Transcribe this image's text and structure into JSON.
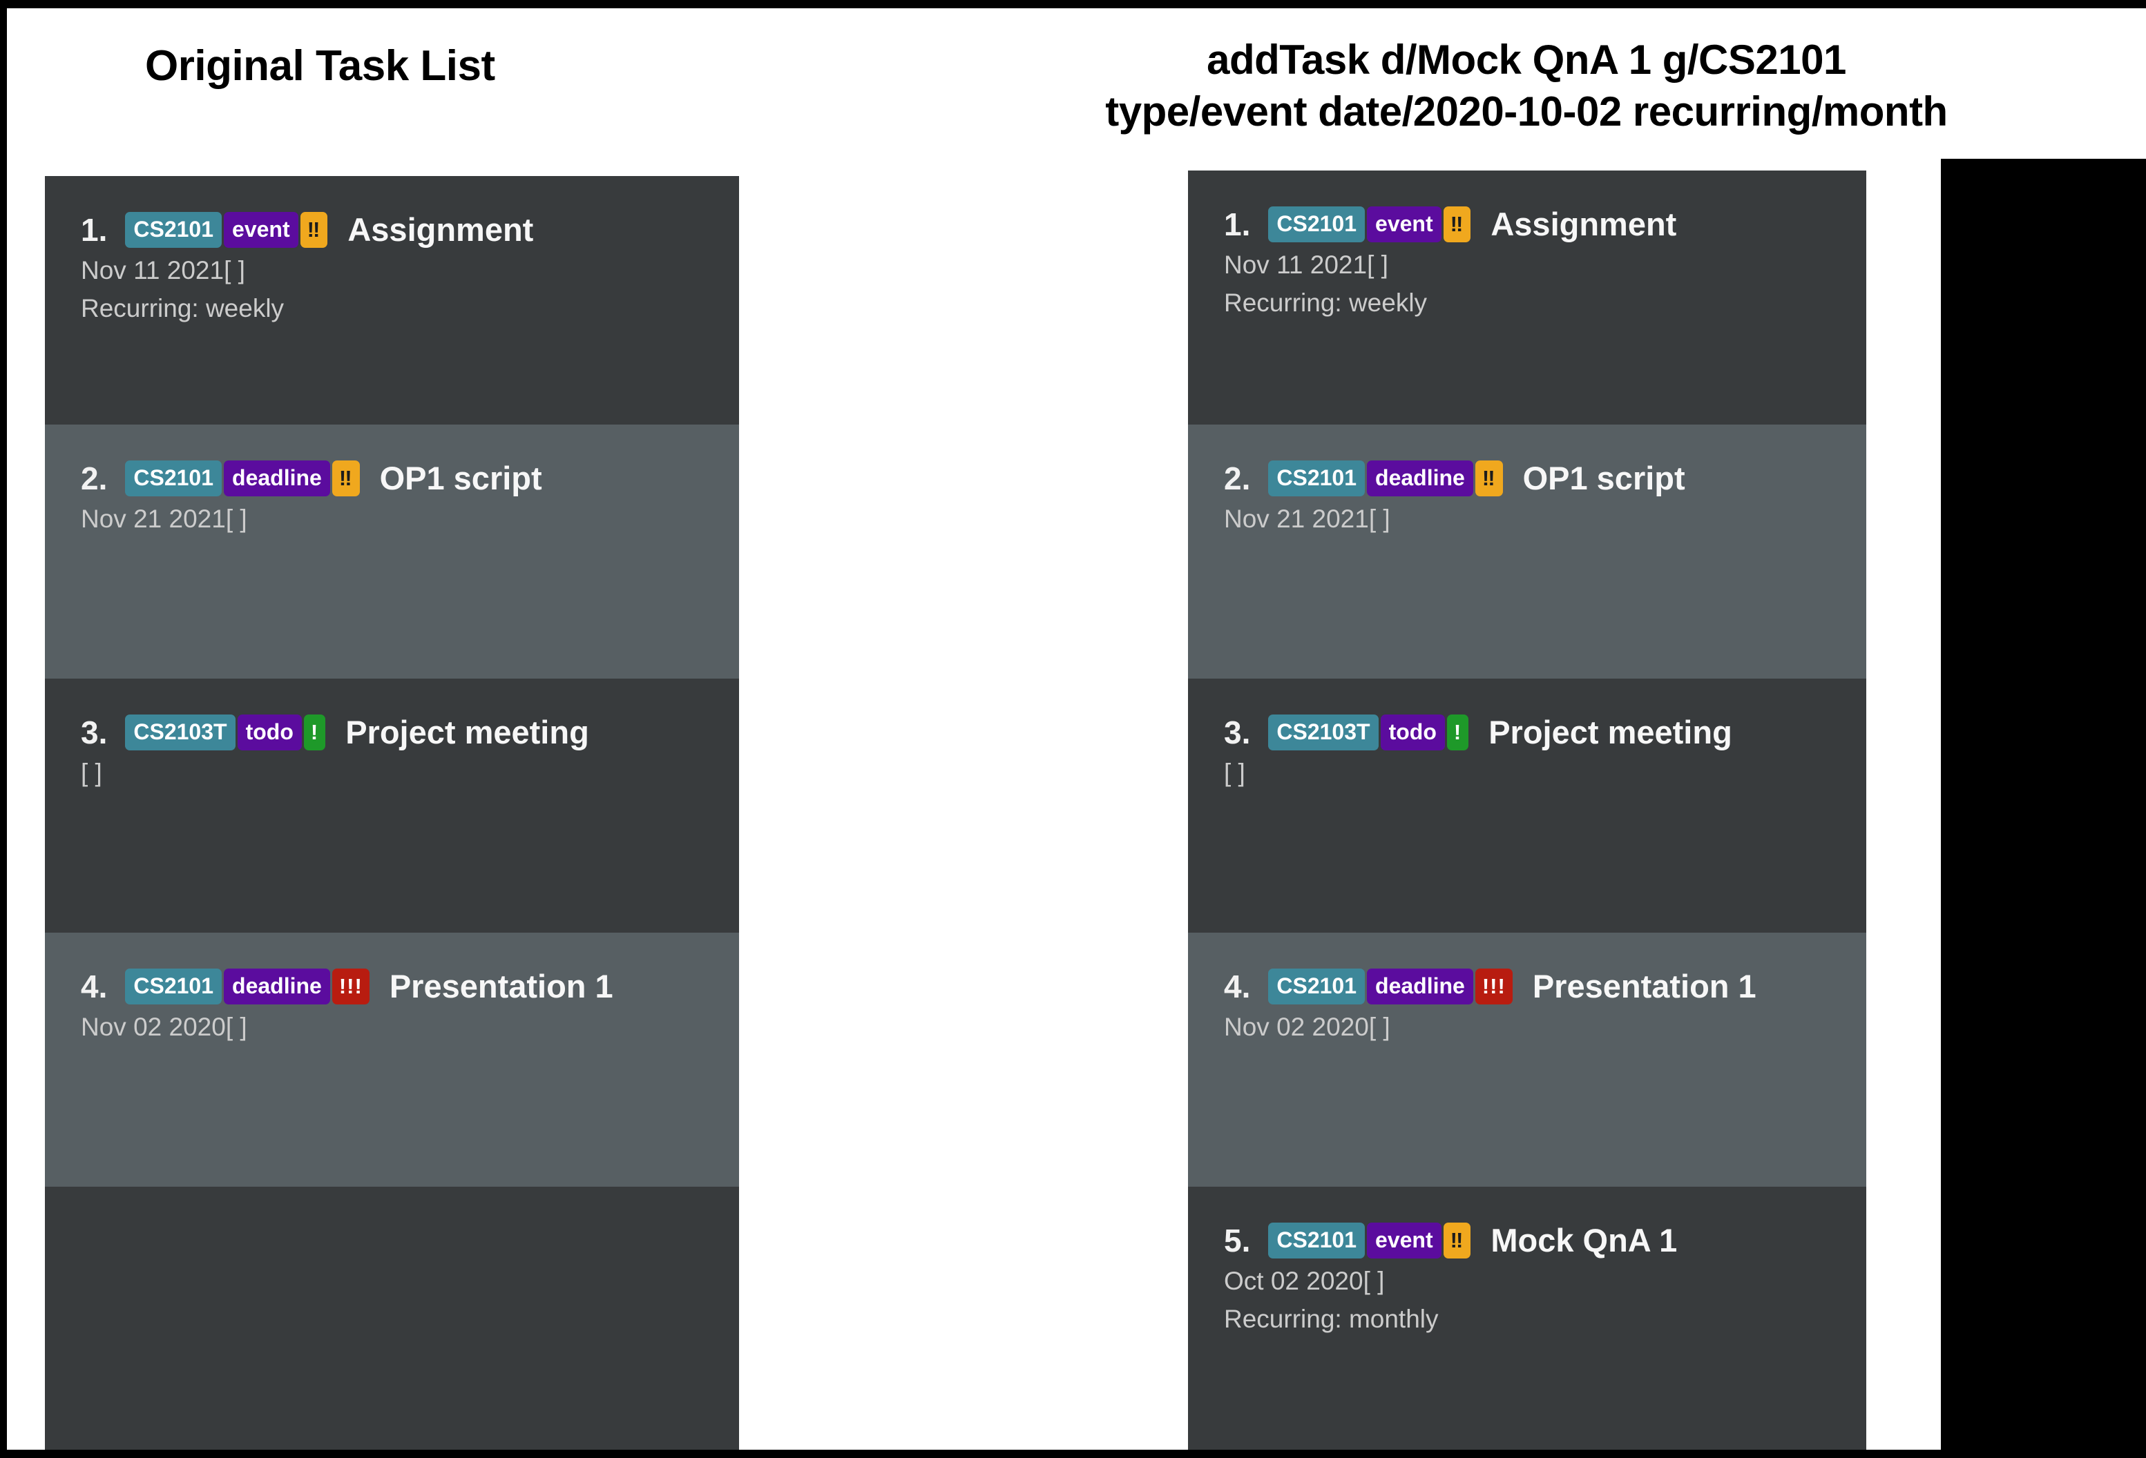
{
  "frame": {
    "background": "#ffffff",
    "border_color": "#000000",
    "black_block_color": "#000000"
  },
  "left_section": {
    "title": "Original Task List"
  },
  "command_header": {
    "line1": "addTask d/Mock QnA 1 g/CS2101",
    "line2": "type/event date/2020-10-02 recurring/month"
  },
  "colors": {
    "panel_dark": "#383b3d",
    "panel_light": "#575f63",
    "tag_module": "#3d8799",
    "tag_type": "#5b0c9e",
    "priority_low": "#1e9929",
    "priority_medium": "#f0a81e",
    "priority_high": "#b81c10",
    "title_text": "#f7f7f7",
    "meta_text": "#cccccc"
  },
  "original_list": {
    "tasks": [
      {
        "index": "1.",
        "module": "CS2101",
        "type": "event",
        "priority": "‼",
        "priority_level": "medium",
        "title": "Assignment",
        "date": "Nov 11 2021[ ]",
        "recurring": "Recurring: weekly"
      },
      {
        "index": "2.",
        "module": "CS2101",
        "type": "deadline",
        "priority": "‼",
        "priority_level": "medium",
        "title": "OP1 script",
        "date": "Nov 21 2021[ ]",
        "recurring": ""
      },
      {
        "index": "3.",
        "module": "CS2103T",
        "type": "todo",
        "priority": "!",
        "priority_level": "low",
        "title": "Project meeting",
        "date": "[ ]",
        "recurring": ""
      },
      {
        "index": "4.",
        "module": "CS2101",
        "type": "deadline",
        "priority": "!!!",
        "priority_level": "high",
        "title": "Presentation 1",
        "date": "Nov 02 2020[ ]",
        "recurring": ""
      }
    ]
  },
  "updated_list": {
    "tasks": [
      {
        "index": "1.",
        "module": "CS2101",
        "type": "event",
        "priority": "‼",
        "priority_level": "medium",
        "title": "Assignment",
        "date": "Nov 11 2021[ ]",
        "recurring": "Recurring: weekly"
      },
      {
        "index": "2.",
        "module": "CS2101",
        "type": "deadline",
        "priority": "‼",
        "priority_level": "medium",
        "title": "OP1 script",
        "date": "Nov 21 2021[ ]",
        "recurring": ""
      },
      {
        "index": "3.",
        "module": "CS2103T",
        "type": "todo",
        "priority": "!",
        "priority_level": "low",
        "title": "Project meeting",
        "date": "[ ]",
        "recurring": ""
      },
      {
        "index": "4.",
        "module": "CS2101",
        "type": "deadline",
        "priority": "!!!",
        "priority_level": "high",
        "title": "Presentation 1",
        "date": "Nov 02 2020[ ]",
        "recurring": ""
      },
      {
        "index": "5.",
        "module": "CS2101",
        "type": "event",
        "priority": "‼",
        "priority_level": "medium",
        "title": "Mock QnA 1",
        "date": "Oct 02 2020[ ]",
        "recurring": "Recurring: monthly"
      }
    ]
  }
}
